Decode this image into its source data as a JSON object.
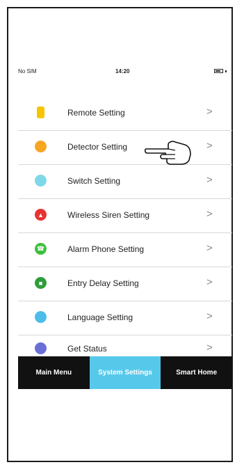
{
  "status_bar": {
    "carrier": "No SIM",
    "time": "14:20"
  },
  "menu": {
    "items": [
      {
        "label": "Remote Setting",
        "icon": "remote-icon",
        "color": "#f7c500"
      },
      {
        "label": "Detector Setting",
        "icon": "detector-icon",
        "color": "#f6a623"
      },
      {
        "label": "Switch Setting",
        "icon": "switch-icon",
        "color": "#7fd8e8"
      },
      {
        "label": "Wireless Siren Setting",
        "icon": "siren-icon",
        "color": "#e8322f"
      },
      {
        "label": "Alarm Phone Setting",
        "icon": "phone-icon",
        "color": "#3fbf3f"
      },
      {
        "label": "Entry Delay Setting",
        "icon": "delay-icon",
        "color": "#2e9e3a"
      },
      {
        "label": "Language Setting",
        "icon": "language-icon",
        "color": "#4cbde8"
      },
      {
        "label": "Get Status",
        "icon": "status-icon",
        "color": "#6a6fd6"
      }
    ]
  },
  "tabs": [
    {
      "label": "Main Menu",
      "active": false
    },
    {
      "label": "System Settings",
      "active": true
    },
    {
      "label": "Smart Home",
      "active": false
    }
  ]
}
